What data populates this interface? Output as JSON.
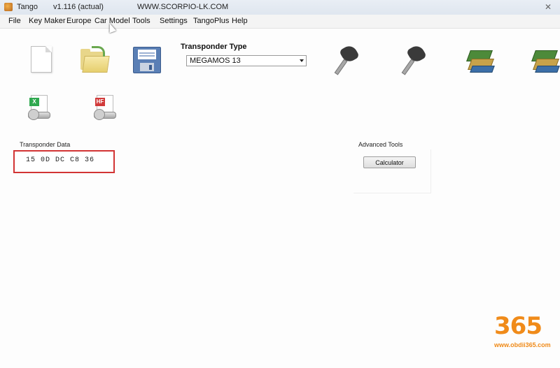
{
  "window": {
    "app_name": "Tango",
    "version": "v1.116 (actual)",
    "url": "WWW.SCORPIO-LK.COM",
    "close_glyph": "✕"
  },
  "menu": [
    "File",
    "Key Maker",
    "Europe",
    "Car Model",
    "Tools",
    "Settings",
    "TangoPlus",
    "Help"
  ],
  "toolbar": {
    "icons": [
      "new-file-icon",
      "open-folder-icon",
      "save-disk-icon",
      "key-read-icon",
      "key-write-icon",
      "books-icon",
      "books-database-icon",
      "x-key-file-icon",
      "hf-key-file-icon"
    ],
    "badge_x": "X",
    "badge_hf": "HF"
  },
  "transponder_type": {
    "label": "Transponder Type",
    "selected": "MEGAMOS 13"
  },
  "transponder_data": {
    "label": "Transponder Data",
    "value": "15 0D DC C8 36"
  },
  "advanced_tools": {
    "label": "Advanced Tools",
    "calculator_label": "Calculator"
  },
  "watermark": {
    "logo": "365",
    "url": "www.obdii365.com"
  },
  "colors": {
    "highlight_border": "#d23434",
    "watermark": "#f08b1a"
  }
}
